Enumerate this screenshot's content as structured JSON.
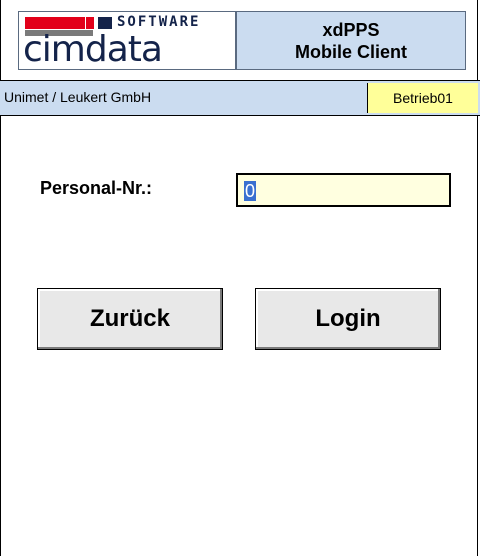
{
  "header": {
    "logo_top": "SOFTWARE",
    "logo_word": "cimdata",
    "title_line1": "xdPPS",
    "title_line2": "Mobile Client"
  },
  "status": {
    "company": "Unimet / Leukert GmbH",
    "plant": "Betrieb01"
  },
  "login": {
    "personal_label": "Personal-Nr.:",
    "personal_value": "0"
  },
  "buttons": {
    "back_label": "Zurück",
    "login_label": "Login"
  },
  "colors": {
    "header_accent": "#cbdcf0",
    "plant_highlight": "#ffff99",
    "logo_red": "#e2001a",
    "logo_navy": "#14234a"
  }
}
